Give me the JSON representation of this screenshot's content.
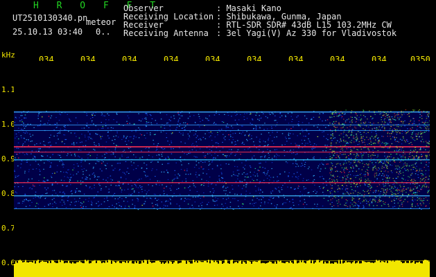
{
  "header": {
    "title": "H R O F F T",
    "filename": "UT2510130340.pn",
    "type_label": "meteor",
    "date_time": "25.10.13 03:40",
    "count": "0.."
  },
  "info": [
    {
      "label": "Observer",
      "value": ": Masaki Kano"
    },
    {
      "label": "Receiving Location",
      "value": ": Shibukawa, Gunma, Japan"
    },
    {
      "label": "Receiver",
      "value": ": RTL-SDR SDR# 43dB L15 103.2MHz CW"
    },
    {
      "label": "Receiving Antenna",
      "value": ": 3el Yagi(V) Az 330 for Vladivostok"
    }
  ],
  "axis": {
    "y_unit": "kHz",
    "y_ticks": [
      "1.1",
      "1.0",
      "0.9",
      "0.8",
      "0.7",
      "0.6"
    ],
    "x_ticks": [
      "034",
      "034",
      "034",
      "034",
      "034",
      "034",
      "034",
      "034",
      "034",
      "0350"
    ]
  },
  "colors": {
    "background": "#000000",
    "title_green": "#22d422",
    "text_white": "#e8e8e8",
    "axis_yellow": "#f2e600",
    "spectrum_dark": "#000050",
    "spectrum_mid": "#1e60ff",
    "spectrum_hot": "#ff2040"
  }
}
